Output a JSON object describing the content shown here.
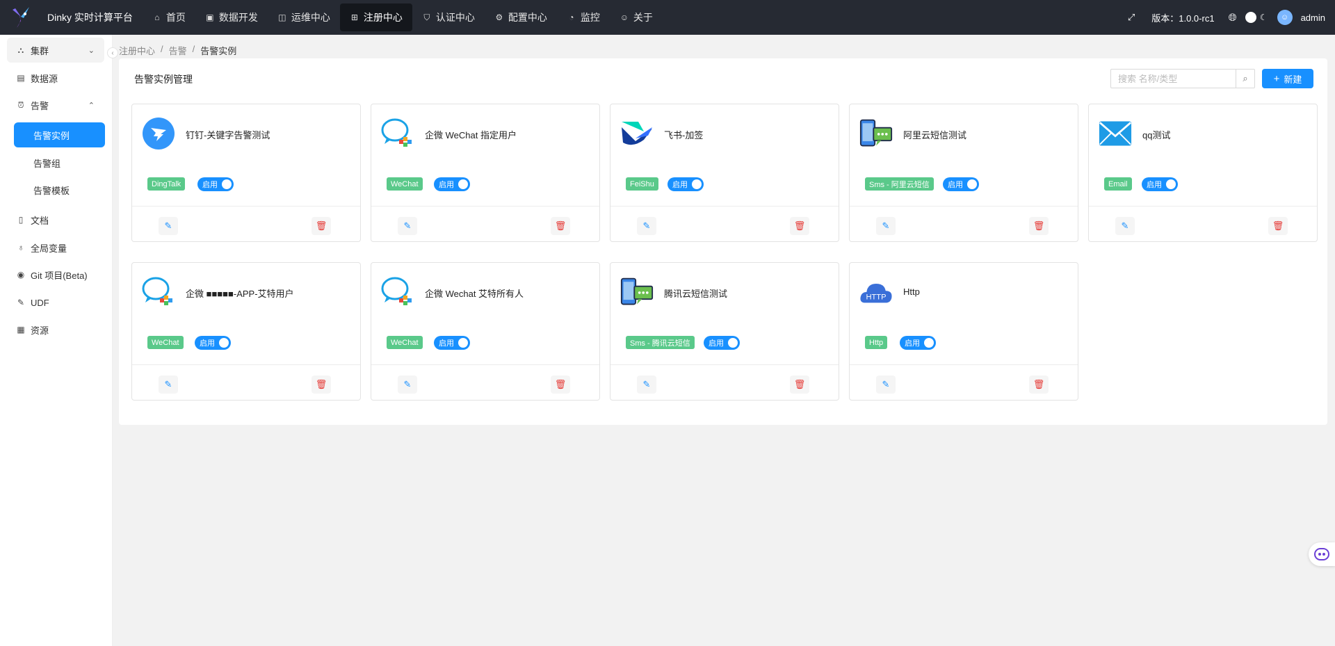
{
  "header": {
    "brand": "Dinky 实时计算平台",
    "nav": [
      {
        "label": "首页",
        "icon": "home-icon"
      },
      {
        "label": "数据开发",
        "icon": "code-icon"
      },
      {
        "label": "运维中心",
        "icon": "ops-icon"
      },
      {
        "label": "注册中心",
        "icon": "grid-icon",
        "active": true
      },
      {
        "label": "认证中心",
        "icon": "shield-icon"
      },
      {
        "label": "配置中心",
        "icon": "gear-icon"
      },
      {
        "label": "监控",
        "icon": "dashboard-icon"
      },
      {
        "label": "关于",
        "icon": "smile-icon"
      }
    ],
    "version": "版本：1.0.0-rc1",
    "user": "admin"
  },
  "breadcrumb": [
    "注册中心",
    "告警",
    "告警实例"
  ],
  "sidebar": {
    "items": [
      {
        "label": "集群",
        "icon": "cluster-icon",
        "expandable": true
      },
      {
        "label": "数据源",
        "icon": "database-icon"
      },
      {
        "label": "告警",
        "icon": "alarm-icon",
        "expanded": true
      },
      {
        "label": "文档",
        "icon": "document-icon"
      },
      {
        "label": "全局变量",
        "icon": "variable-icon"
      },
      {
        "label": "Git 项目(Beta)",
        "icon": "github-icon"
      },
      {
        "label": "UDF",
        "icon": "tool-icon"
      },
      {
        "label": "资源",
        "icon": "resource-icon"
      }
    ],
    "alert_sub": [
      "告警实例",
      "告警组",
      "告警模板"
    ]
  },
  "panel": {
    "title": "告警实例管理",
    "search_placeholder": "搜索 名称/类型",
    "new_label": "新建"
  },
  "switch_label": "启用",
  "cards": [
    {
      "title": "钉钉-关键字告警测试",
      "tag": "DingTalk",
      "logo": "dingtalk-icon",
      "enabled": true
    },
    {
      "title": "企微 WeChat 指定用户",
      "tag": "WeChat",
      "logo": "wechat-icon",
      "enabled": true
    },
    {
      "title": "飞书-加签",
      "tag": "FeiShu",
      "logo": "feishu-icon",
      "enabled": true
    },
    {
      "title": "阿里云短信测试",
      "tag": "Sms - 阿里云短信",
      "logo": "sms-icon",
      "enabled": true
    },
    {
      "title": "qq测试",
      "tag": "Email",
      "logo": "email-icon",
      "enabled": true
    },
    {
      "title": "企微 ■■■■■-APP-艾特用户",
      "tag": "WeChat",
      "logo": "wechat-icon",
      "enabled": true
    },
    {
      "title": "企微 Wechat 艾特所有人",
      "tag": "WeChat",
      "logo": "wechat-icon",
      "enabled": true
    },
    {
      "title": "腾讯云短信测试",
      "tag": "Sms - 腾讯云短信",
      "logo": "sms-icon",
      "enabled": true
    },
    {
      "title": "Http",
      "tag": "Http",
      "logo": "http-cloud-icon",
      "enabled": true
    }
  ],
  "colors": {
    "primary": "#1890ff",
    "header": "#262a33",
    "tag": "#5ac98a",
    "danger": "#e53935"
  }
}
